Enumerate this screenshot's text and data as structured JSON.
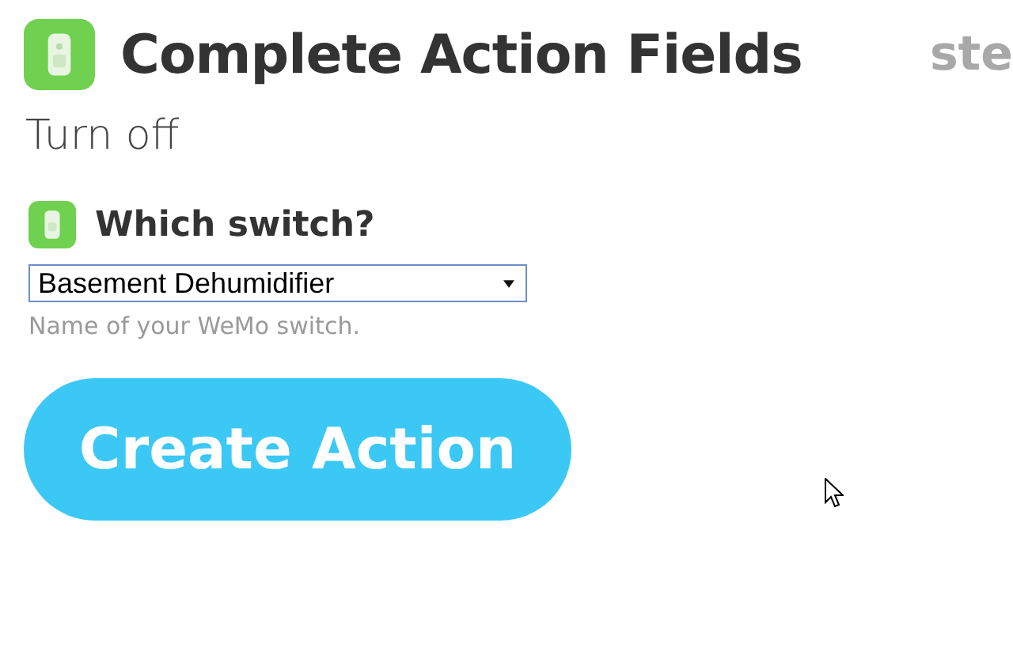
{
  "header": {
    "title": "Complete Action Fields",
    "step_label": "ste"
  },
  "action_name": "Turn off",
  "field": {
    "label": "Which switch?",
    "value": "Basement Dehumidifier",
    "hint": "Name of your WeMo switch."
  },
  "submit_button": {
    "label": "Create Action"
  }
}
